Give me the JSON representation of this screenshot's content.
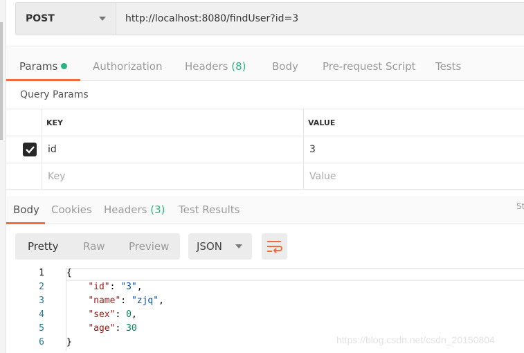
{
  "request": {
    "method": "POST",
    "url": "http://localhost:8080/findUser?id=3"
  },
  "req_tabs": [
    {
      "label": "Params"
    },
    {
      "label": "Authorization"
    },
    {
      "label": "Headers",
      "count": "(8)"
    },
    {
      "label": "Body"
    },
    {
      "label": "Pre-request Script"
    },
    {
      "label": "Tests"
    }
  ],
  "query_params": {
    "title": "Query Params",
    "headers": [
      "KEY",
      "VALUE"
    ],
    "rows": [
      {
        "checked": true,
        "key": "id",
        "value": "3"
      }
    ],
    "placeholder": {
      "key": "Key",
      "value": "Value"
    }
  },
  "resp_tabs": [
    {
      "label": "Body"
    },
    {
      "label": "Cookies"
    },
    {
      "label": "Headers",
      "count": "(3)"
    },
    {
      "label": "Test Results"
    }
  ],
  "status_partial": "St",
  "view_modes": [
    "Pretty",
    "Raw",
    "Preview"
  ],
  "format": "JSON",
  "code": {
    "line_numbers": [
      "1",
      "2",
      "3",
      "4",
      "5",
      "6"
    ],
    "lines": [
      "{",
      "    \"id\": \"3\",",
      "    \"name\": \"zjq\",",
      "    \"sex\": 0,",
      "    \"age\": 30",
      "}"
    ]
  },
  "watermark": "https://blog.csdn.net/csdn_20150804",
  "colors": {
    "accent": "#f26b3a",
    "green": "#26b47f"
  }
}
